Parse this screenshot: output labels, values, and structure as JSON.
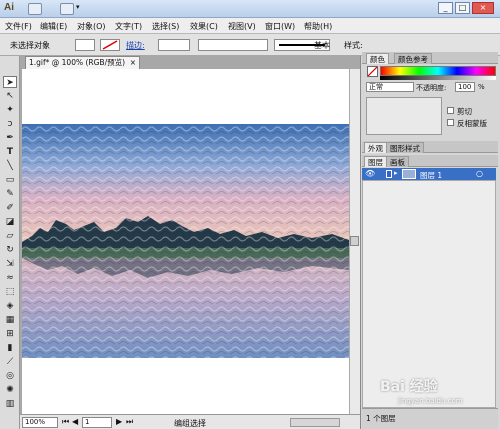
{
  "app": {
    "logo": "Ai"
  },
  "window_controls": {
    "minimize": "_",
    "restore": "□",
    "close": "×"
  },
  "menu": [
    "文件(F)",
    "编辑(E)",
    "对象(O)",
    "文字(T)",
    "选择(S)",
    "效果(C)",
    "视图(V)",
    "窗口(W)",
    "帮助(H)"
  ],
  "controlbar": {
    "selection_label": "未选择对象",
    "stroke_label": "描边:",
    "stroke_style": "基本",
    "style_label": "样式:"
  },
  "document": {
    "tab_title": "1.gif* @ 100% (RGB/预览)",
    "zoom": "100%",
    "page": "1",
    "status_text": "编组选择"
  },
  "panels": {
    "color_tabs": [
      "颜色",
      "颜色参考"
    ],
    "blend_mode": "正常",
    "opacity_label": "不透明度:",
    "opacity_value": "100",
    "opacity_unit": "%",
    "clip_label": "剪切",
    "invert_mask_label": "反相蒙版",
    "appearance_tabs": [
      "外观",
      "图形样式"
    ],
    "layers_tabs": [
      "图层",
      "画板"
    ],
    "layer_name": "图层 1",
    "layers_count": "1 个图层"
  },
  "watermark": {
    "main": "Bai 经验",
    "sub": "jingyan.baidu.com"
  },
  "colors": {
    "selected_layer": "#3a6fc6",
    "titlebar": "#c5d7ef"
  }
}
